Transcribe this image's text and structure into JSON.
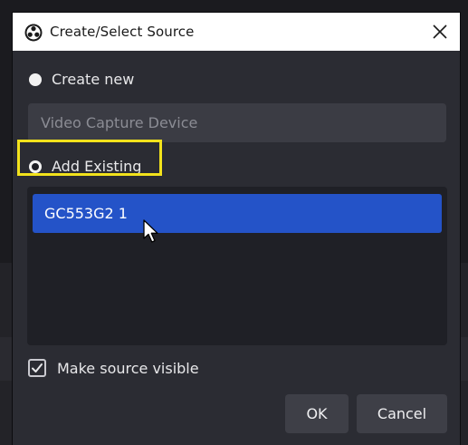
{
  "dialog": {
    "title": "Create/Select Source",
    "create_new_label": "Create new",
    "new_source_name": "Video Capture Device",
    "add_existing_label": "Add Existing",
    "existing_sources": [
      "GC553G2 1"
    ],
    "selected_source": "GC553G2 1",
    "make_visible_label": "Make source visible",
    "make_visible_checked": true,
    "ok_label": "OK",
    "cancel_label": "Cancel"
  },
  "colors": {
    "dialog_bg": "#2b2c33",
    "title_bg": "#ffffff",
    "selection": "#2453c8",
    "highlight": "#f2e21c"
  },
  "icons": {
    "title": "obs-logo-icon",
    "close": "close-icon",
    "checkbox": "checkmark-icon",
    "pointer": "mouse-pointer-icon"
  }
}
